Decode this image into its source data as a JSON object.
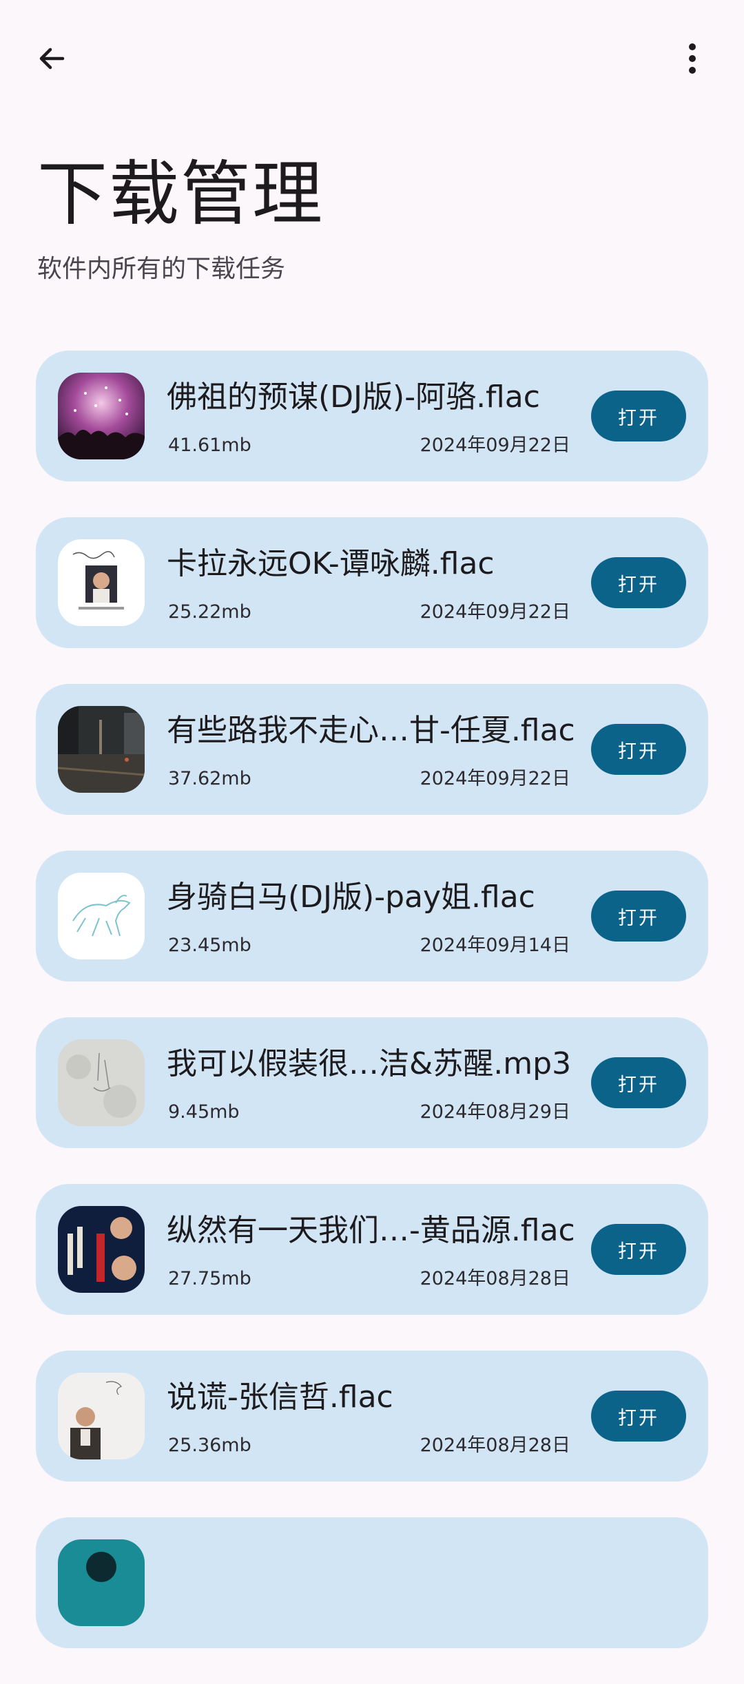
{
  "header": {
    "back_icon": "arrow-left-icon",
    "more_icon": "more-vert-icon",
    "title": "下载管理",
    "subtitle": "软件内所有的下载任务"
  },
  "colors": {
    "background": "#fbf7fb",
    "card": "#d2e5f4",
    "button": "#0c6389",
    "button_text": "#ffffff"
  },
  "downloads": [
    {
      "name": "佛祖的预谋(DJ版)-阿骆.flac",
      "size": "41.61mb",
      "date": "2024年09月22日",
      "action": "打开",
      "cover": "concert-crowd"
    },
    {
      "name": "卡拉永远OK-谭咏麟.flac",
      "size": "25.22mb",
      "date": "2024年09月22日",
      "action": "打开",
      "cover": "portrait-white"
    },
    {
      "name": "有些路我不走心…甘-任夏.flac",
      "size": "37.62mb",
      "date": "2024年09月22日",
      "action": "打开",
      "cover": "rainy-street"
    },
    {
      "name": "身骑白马(DJ版)-pay姐.flac",
      "size": "23.45mb",
      "date": "2024年09月14日",
      "action": "打开",
      "cover": "horse-sketch"
    },
    {
      "name": "我可以假装很…洁&苏醒.mp3",
      "size": "9.45mb",
      "date": "2024年08月29日",
      "action": "打开",
      "cover": "grey-texture"
    },
    {
      "name": "纵然有一天我们…-黄品源.flac",
      "size": "27.75mb",
      "date": "2024年08月28日",
      "action": "打开",
      "cover": "dark-blue-album"
    },
    {
      "name": "说谎-张信哲.flac",
      "size": "25.36mb",
      "date": "2024年08月28日",
      "action": "打开",
      "cover": "portrait-light"
    },
    {
      "name": "",
      "size": "",
      "date": "",
      "action": "",
      "cover": "teal-partial"
    }
  ]
}
